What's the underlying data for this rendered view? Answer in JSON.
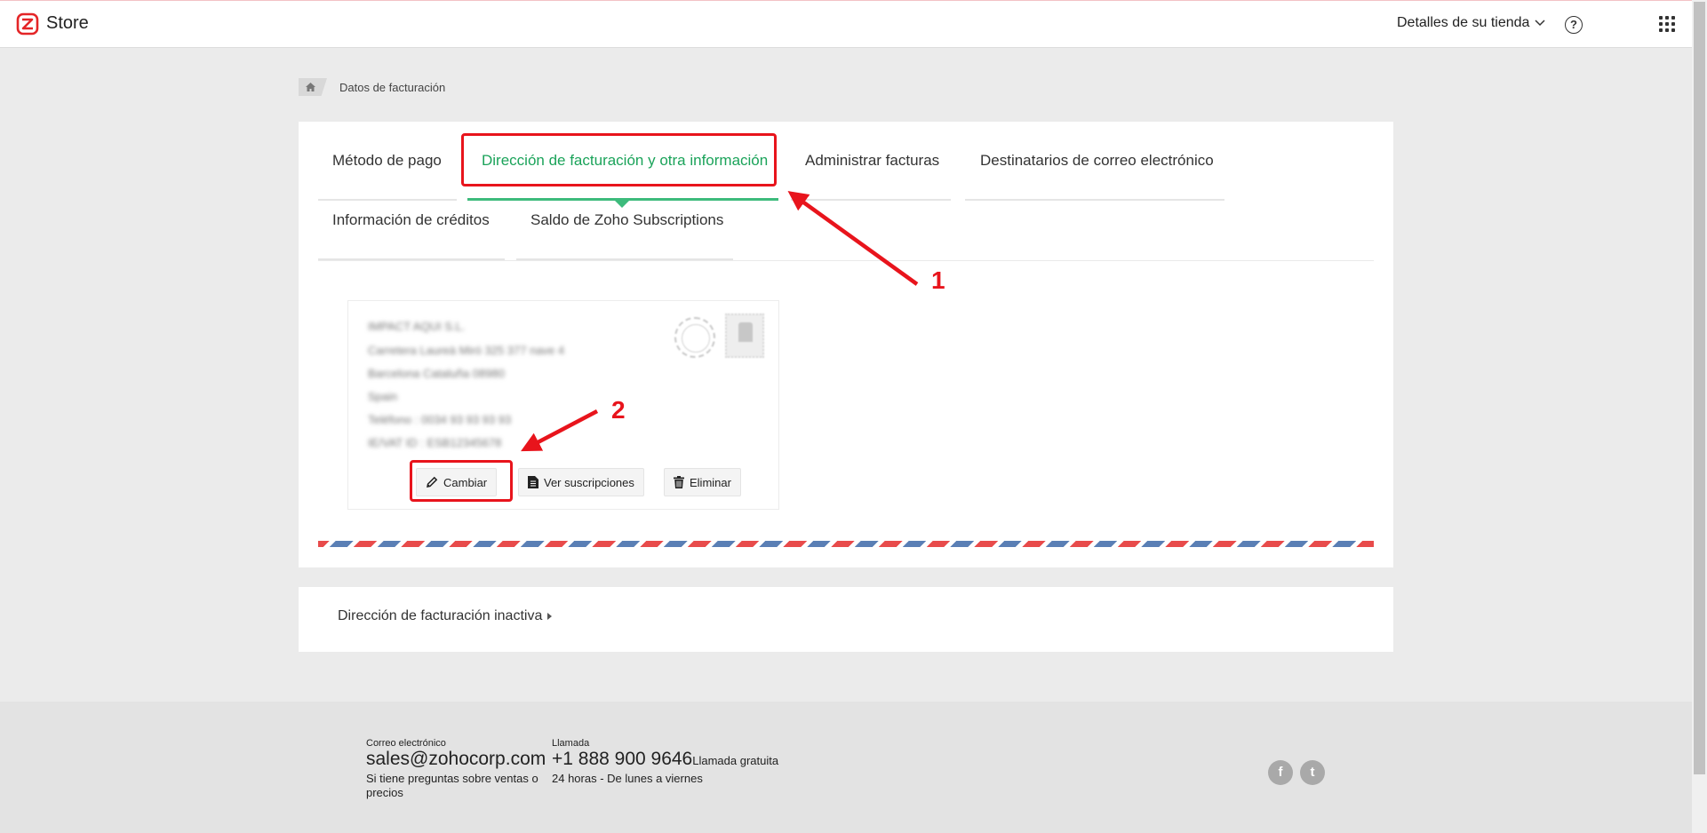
{
  "header": {
    "brand": "Store",
    "store_menu_label": "Detalles de su tienda",
    "help_glyph": "?"
  },
  "breadcrumb": {
    "current": "Datos de facturación"
  },
  "tabs": [
    {
      "label": "Método de pago",
      "active": false
    },
    {
      "label": "Dirección de facturación y otra información",
      "active": true
    },
    {
      "label": "Administrar facturas",
      "active": false
    },
    {
      "label": "Destinatarios de correo electrónico",
      "active": false
    },
    {
      "label": "Información de créditos",
      "active": false
    },
    {
      "label": "Saldo de Zoho Subscriptions",
      "active": false
    }
  ],
  "address_card": {
    "lines": [
      "IMPACT AQUI S.L.",
      "Carretera Laureà Miró 325 377 nave 4",
      "Barcelona Cataluña 08980",
      "Spain",
      "Teléfono : 0034 93 93 93 93",
      "IE/VAT ID : ESB12345678"
    ],
    "buttons": {
      "change": "Cambiar",
      "view_subscriptions": "Ver suscripciones",
      "delete": "Eliminar"
    }
  },
  "inactive_section": {
    "label": "Dirección de facturación inactiva"
  },
  "footer": {
    "email_label": "Correo electrónico",
    "email": "sales@zohocorp.com",
    "email_note": "Si tiene preguntas sobre ventas o precios",
    "call_label": "Llamada",
    "phone": "+1 888 900 9646",
    "phone_free": "Llamada gratuita",
    "hours": "24 horas - De lunes a viernes",
    "facebook_glyph": "f",
    "twitter_glyph": "t"
  },
  "annotations": {
    "first": "1",
    "second": "2"
  },
  "colors": {
    "accent_green": "#1ba35a",
    "annotation_red": "#e8141c",
    "airmail_red": "#e84b4b",
    "airmail_blue": "#5a7fb5"
  }
}
